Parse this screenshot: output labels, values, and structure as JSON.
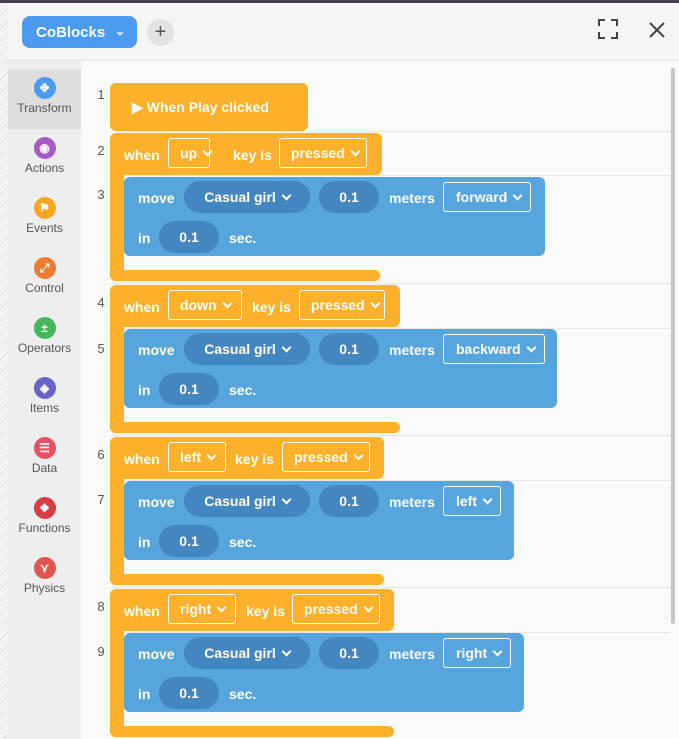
{
  "header": {
    "project_label": "CoBlocks",
    "add_label": "+"
  },
  "sidebar": {
    "categories": [
      {
        "label": "Transform",
        "color": "#4b9bf2",
        "glyph": "✥"
      },
      {
        "label": "Actions",
        "color": "#a75bc9",
        "glyph": "◉"
      },
      {
        "label": "Events",
        "color": "#f6a623",
        "glyph": "⚑"
      },
      {
        "label": "Control",
        "color": "#f07a30",
        "glyph": "⤢"
      },
      {
        "label": "Operators",
        "color": "#45b65a",
        "glyph": "±"
      },
      {
        "label": "Items",
        "color": "#6a63c9",
        "glyph": "◈"
      },
      {
        "label": "Data",
        "color": "#ea4f64",
        "glyph": "☰"
      },
      {
        "label": "Functions",
        "color": "#d63d45",
        "glyph": "❖"
      },
      {
        "label": "Physics",
        "color": "#e0564e",
        "glyph": "⋎"
      }
    ]
  },
  "code": {
    "line_numbers": [
      "1",
      "2",
      "3",
      "4",
      "5",
      "6",
      "7",
      "8",
      "9"
    ],
    "play_block": "▶ When Play clicked",
    "kw_when": "when",
    "kw_key_is": "key is",
    "kw_move": "move",
    "kw_meters": "meters",
    "kw_in": "in",
    "kw_sec": "sec.",
    "events": [
      {
        "key": "up",
        "state": "pressed",
        "object": "Casual girl",
        "distance": "0.1",
        "direction": "forward",
        "duration": "0.1"
      },
      {
        "key": "down",
        "state": "pressed",
        "object": "Casual girl",
        "distance": "0.1",
        "direction": "backward",
        "duration": "0.1"
      },
      {
        "key": "left",
        "state": "pressed",
        "object": "Casual girl",
        "distance": "0.1",
        "direction": "left",
        "duration": "0.1"
      },
      {
        "key": "right",
        "state": "pressed",
        "object": "Casual girl",
        "distance": "0.1",
        "direction": "right",
        "duration": "0.1"
      }
    ]
  }
}
